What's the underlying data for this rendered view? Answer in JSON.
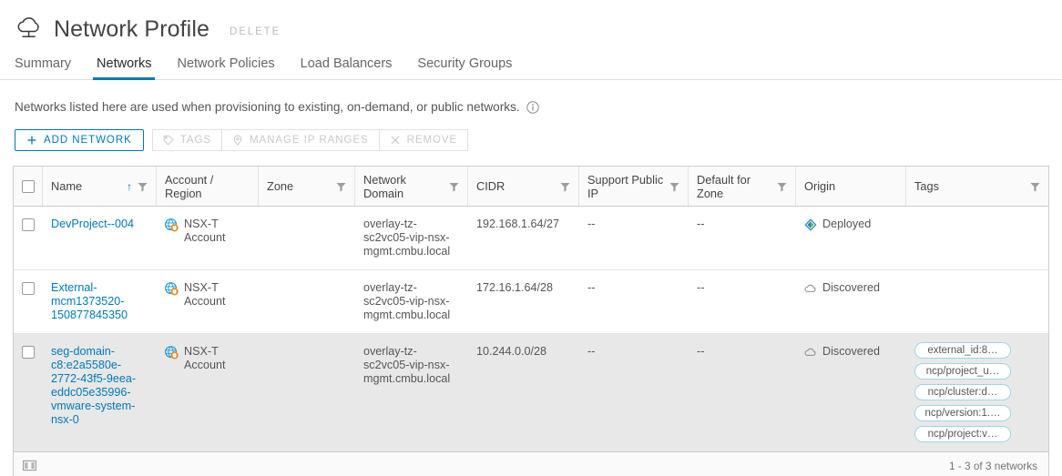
{
  "header": {
    "icon": "cloud-network-icon",
    "title": "Network Profile",
    "delete_label": "DELETE"
  },
  "tabs": [
    {
      "label": "Summary",
      "active": false
    },
    {
      "label": "Networks",
      "active": true
    },
    {
      "label": "Network Policies",
      "active": false
    },
    {
      "label": "Load Balancers",
      "active": false
    },
    {
      "label": "Security Groups",
      "active": false
    }
  ],
  "description": {
    "text": "Networks listed here are used when provisioning to existing, on-demand, or public networks.",
    "info_icon": "info-circle-icon"
  },
  "toolbar": {
    "add_network": {
      "label": "ADD NETWORK",
      "icon": "plus-icon",
      "enabled": true
    },
    "tags": {
      "label": "TAGS",
      "icon": "tag-icon",
      "enabled": false
    },
    "manage_ip_ranges": {
      "label": "MANAGE IP RANGES",
      "icon": "pin-icon",
      "enabled": false
    },
    "remove": {
      "label": "REMOVE",
      "icon": "close-x-icon",
      "enabled": false
    }
  },
  "table": {
    "columns": [
      {
        "key": "check",
        "label": "",
        "filter": false,
        "sort": null
      },
      {
        "key": "name",
        "label": "Name",
        "filter": true,
        "sort": "asc"
      },
      {
        "key": "acct",
        "label": "Account / Region",
        "filter": false,
        "sort": null
      },
      {
        "key": "zone",
        "label": "Zone",
        "filter": true,
        "sort": null
      },
      {
        "key": "netd",
        "label": "Network Domain",
        "filter": true,
        "sort": null
      },
      {
        "key": "cidr",
        "label": "CIDR",
        "filter": true,
        "sort": null
      },
      {
        "key": "pub",
        "label": "Support Public IP",
        "filter": true,
        "sort": null
      },
      {
        "key": "defz",
        "label": "Default for Zone",
        "filter": true,
        "sort": null
      },
      {
        "key": "orig",
        "label": "Origin",
        "filter": false,
        "sort": null
      },
      {
        "key": "tags",
        "label": "Tags",
        "filter": true,
        "sort": null
      }
    ],
    "rows": [
      {
        "selected": false,
        "checked": false,
        "name": "DevProject--004",
        "account": "NSX-T Account",
        "account_icon": "nsx-account-icon",
        "zone": "",
        "network_domain": "overlay-tz-sc2vc05-vip-nsx-mgmt.cmbu.local",
        "cidr": "192.168.1.64/27",
        "support_public_ip": "--",
        "default_for_zone": "--",
        "origin": "Deployed",
        "origin_icon": "deployed-diamond-icon",
        "tags": []
      },
      {
        "selected": false,
        "checked": false,
        "name": "External-mcm1373520-150877845350",
        "account": "NSX-T Account",
        "account_icon": "nsx-account-icon",
        "zone": "",
        "network_domain": "overlay-tz-sc2vc05-vip-nsx-mgmt.cmbu.local",
        "cidr": "172.16.1.64/28",
        "support_public_ip": "--",
        "default_for_zone": "--",
        "origin": "Discovered",
        "origin_icon": "discovered-cloud-icon",
        "tags": []
      },
      {
        "selected": true,
        "checked": false,
        "name": "seg-domain-c8:e2a5580e-2772-43f5-9eea-eddc05e35996-vmware-system-nsx-0",
        "account": "NSX-T Account",
        "account_icon": "nsx-account-icon",
        "zone": "",
        "network_domain": "overlay-tz-sc2vc05-vip-nsx-mgmt.cmbu.local",
        "cidr": "10.244.0.0/28",
        "support_public_ip": "--",
        "default_for_zone": "--",
        "origin": "Discovered",
        "origin_icon": "discovered-cloud-icon",
        "tags": [
          "external_id:8…",
          "ncp/project_u…",
          "ncp/cluster:d…",
          "ncp/version:1.…",
          "ncp/project:v…"
        ]
      }
    ]
  },
  "footer": {
    "column_toggle_icon": "column-layout-icon",
    "count_text": "1 - 3 of 3 networks"
  },
  "colors": {
    "accent": "#0079b8",
    "link": "#0079b8",
    "text": "#565656",
    "selected_row": "#e8e8e8",
    "tag_border": "#9fd5e8",
    "badge_orange": "#f4861f"
  }
}
